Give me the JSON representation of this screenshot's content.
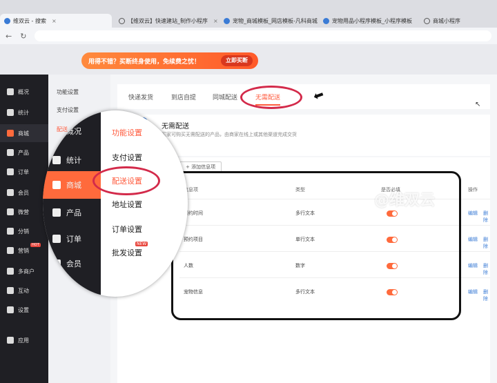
{
  "browser": {
    "tabs": [
      {
        "label": "维双云 - 搜索"
      },
      {
        "label": "【维双云】快速建站_制作小程序"
      },
      {
        "label": "宠物_商城模板_网店模板-凡科商城"
      },
      {
        "label": "宠物用品小程序模板_小程序模板"
      },
      {
        "label": "商城小程序"
      }
    ]
  },
  "promo": {
    "text": "用得不错？买断终身使用，免续费之忧！",
    "button": "立即买断"
  },
  "sidebar": {
    "items": [
      {
        "label": "概况"
      },
      {
        "label": "统计"
      },
      {
        "label": "商城"
      },
      {
        "label": "产品"
      },
      {
        "label": "订单"
      },
      {
        "label": "会员"
      },
      {
        "label": "微营"
      },
      {
        "label": "分销"
      },
      {
        "label": "营销"
      },
      {
        "label": "多商户"
      },
      {
        "label": "互动"
      },
      {
        "label": "设置"
      },
      {
        "label": "应用"
      }
    ],
    "hot_badge": "HOT"
  },
  "subnav": {
    "items": [
      {
        "label": "功能设置"
      },
      {
        "label": "支付设置"
      },
      {
        "label": "配送"
      }
    ]
  },
  "tabs": {
    "items": [
      {
        "label": "快递发货"
      },
      {
        "label": "到店自提"
      },
      {
        "label": "同城配送"
      },
      {
        "label": "无需配送"
      }
    ]
  },
  "card": {
    "title": "无需配送",
    "desc": "买家可购买无需配送的产品，由商家在线上或其他渠道完成交货"
  },
  "table": {
    "add_button": "+ 添加信息项",
    "headers": {
      "name": "信息项",
      "type": "类型",
      "required": "是否必填",
      "ops": "操作"
    },
    "rows": [
      {
        "name": "预约时间",
        "type": "多行文本",
        "edit": "编辑",
        "delete": "删除"
      },
      {
        "name": "预约项目",
        "type": "单行文本",
        "edit": "编辑",
        "delete": "删除"
      },
      {
        "name": "人数",
        "type": "数字",
        "edit": "编辑",
        "delete": "删除"
      },
      {
        "name": "宠物信息",
        "type": "多行文本",
        "edit": "编辑",
        "delete": "删除"
      }
    ]
  },
  "watermark": "@维双云",
  "magnifier": {
    "left_items": [
      {
        "label": "概况"
      },
      {
        "label": "统计"
      },
      {
        "label": "商城"
      },
      {
        "label": "产品"
      },
      {
        "label": "订单"
      },
      {
        "label": "会员"
      }
    ],
    "right_items": [
      {
        "label": "功能设置"
      },
      {
        "label": "支付设置"
      },
      {
        "label": "配送设置"
      },
      {
        "label": "地址设置"
      },
      {
        "label": "订单设置"
      },
      {
        "label": "批发设置"
      }
    ],
    "new_badge": "NEW"
  },
  "colors": {
    "accent": "#ff5a3c",
    "sidebar": "#1f1f24",
    "ring": "#d32a4a"
  }
}
